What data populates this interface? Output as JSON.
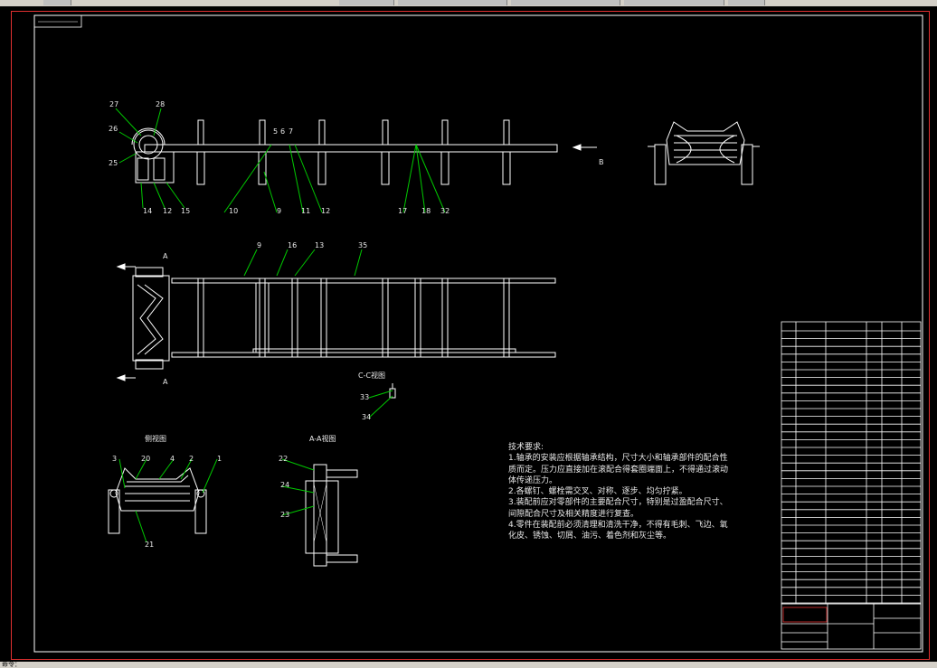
{
  "status_text": "命令：",
  "view_labels": {
    "section_aa": "A-A视图",
    "section_cc": "C-C视图",
    "view_side": "侧视图",
    "arrow_a_top": "A",
    "arrow_a_bottom": "A",
    "arrow_b": "B"
  },
  "part_numbers_front": [
    "27",
    "28",
    "26",
    "25",
    "14",
    "12",
    "15",
    "10",
    "9",
    "11",
    "12",
    "5",
    "6",
    "7",
    "17",
    "18",
    "32"
  ],
  "part_numbers_plan": [
    "9",
    "16",
    "13",
    "35"
  ],
  "part_numbers_cc": [
    "33",
    "34"
  ],
  "part_numbers_side": [
    "3",
    "20",
    "4",
    "2",
    "1",
    "21"
  ],
  "part_numbers_aa": [
    "22",
    "24",
    "23"
  ],
  "tech_requirements": {
    "title": "技术要求:",
    "lines": [
      "1.轴承的安装应根据轴承结构，尺寸大小和轴承部件的配合性",
      "质而定。压力应直接加在滚配合得套圈端面上，不得通过滚动",
      "体传递压力。",
      "2.各螺钉、螺栓需交叉、对称、逐步、均匀拧紧。",
      "3.装配前应对零部件的主要配合尺寸，特别是过盈配合尺寸、",
      "间隙配合尺寸及相关精度进行复查。",
      "4.零件在装配前必须清理和清洗干净，不得有毛刺、飞边、氧",
      "化皮、锈蚀、切屑、油污、着色剂和灰尘等。"
    ]
  },
  "colors": {
    "background": "#000000",
    "line": "#ffffff",
    "leader": "#00c800",
    "border": "#e03030",
    "table": "#ffffff"
  }
}
